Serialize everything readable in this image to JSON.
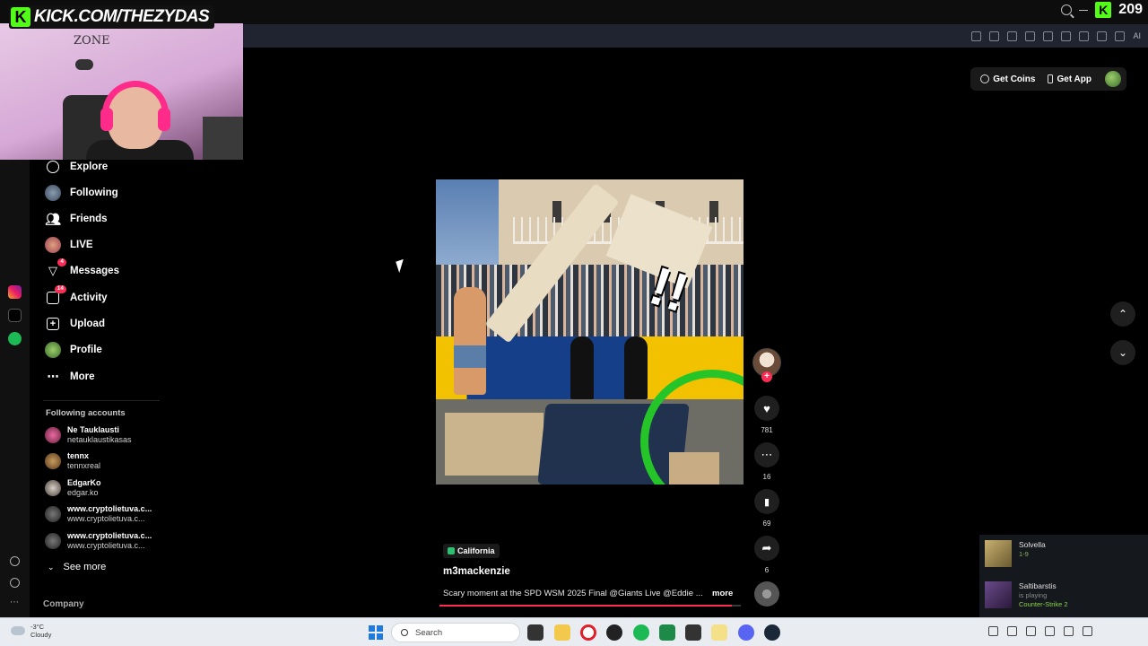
{
  "stream": {
    "kick_url": "KICK.COM/THEZYDAS",
    "viewer_count": "209",
    "webcam_wall_text": "ZONE"
  },
  "top_buttons": {
    "get_coins": "Get Coins",
    "get_app": "Get App"
  },
  "browser": {
    "ai_label": "AI"
  },
  "sidebar": {
    "nav": [
      {
        "label": "Explore",
        "icon": "compass-icon"
      },
      {
        "label": "Following",
        "icon": "following-avatar-icon"
      },
      {
        "label": "Friends",
        "icon": "friends-icon"
      },
      {
        "label": "LIVE",
        "icon": "live-icon"
      },
      {
        "label": "Messages",
        "icon": "messages-icon",
        "badge": "4"
      },
      {
        "label": "Activity",
        "icon": "activity-icon",
        "badge": "14"
      },
      {
        "label": "Upload",
        "icon": "upload-icon"
      },
      {
        "label": "Profile",
        "icon": "profile-icon"
      },
      {
        "label": "More",
        "icon": "more-icon"
      }
    ],
    "following_title": "Following accounts",
    "accounts": [
      {
        "name": "Ne Tauklausti",
        "handle": "netauklaustikasas"
      },
      {
        "name": "tennx",
        "handle": "tennxreal"
      },
      {
        "name": "EdgarKo",
        "handle": "edgar.ko"
      },
      {
        "name": "www.cryptolietuva.c...",
        "handle": "www.cryptolietuva.c..."
      },
      {
        "name": "www.cryptolietuva.c...",
        "handle": "www.cryptolietuva.c..."
      }
    ],
    "see_more": "See more",
    "company": "Company"
  },
  "video": {
    "location": "California",
    "author": "m3mackenzie",
    "description": "Scary moment at the SPD WSM 2025 Final @Giants Live @Eddie ...",
    "more": "more",
    "progress": 0.97,
    "likes": "781",
    "comments": "16",
    "saves": "69",
    "shares": "6",
    "exclaim": "!!"
  },
  "friends": [
    {
      "name": "Solvella",
      "status": "1-9"
    },
    {
      "name": "Saltibarstis",
      "status": "is playing",
      "game": "Counter-Strike 2"
    }
  ],
  "taskbar": {
    "temperature": "-3°C",
    "weather": "Cloudy",
    "search": "Search"
  },
  "colors": {
    "kick_green": "#53fc18",
    "tiktok_red": "#fe2c55",
    "ring_green": "#25c52a"
  }
}
